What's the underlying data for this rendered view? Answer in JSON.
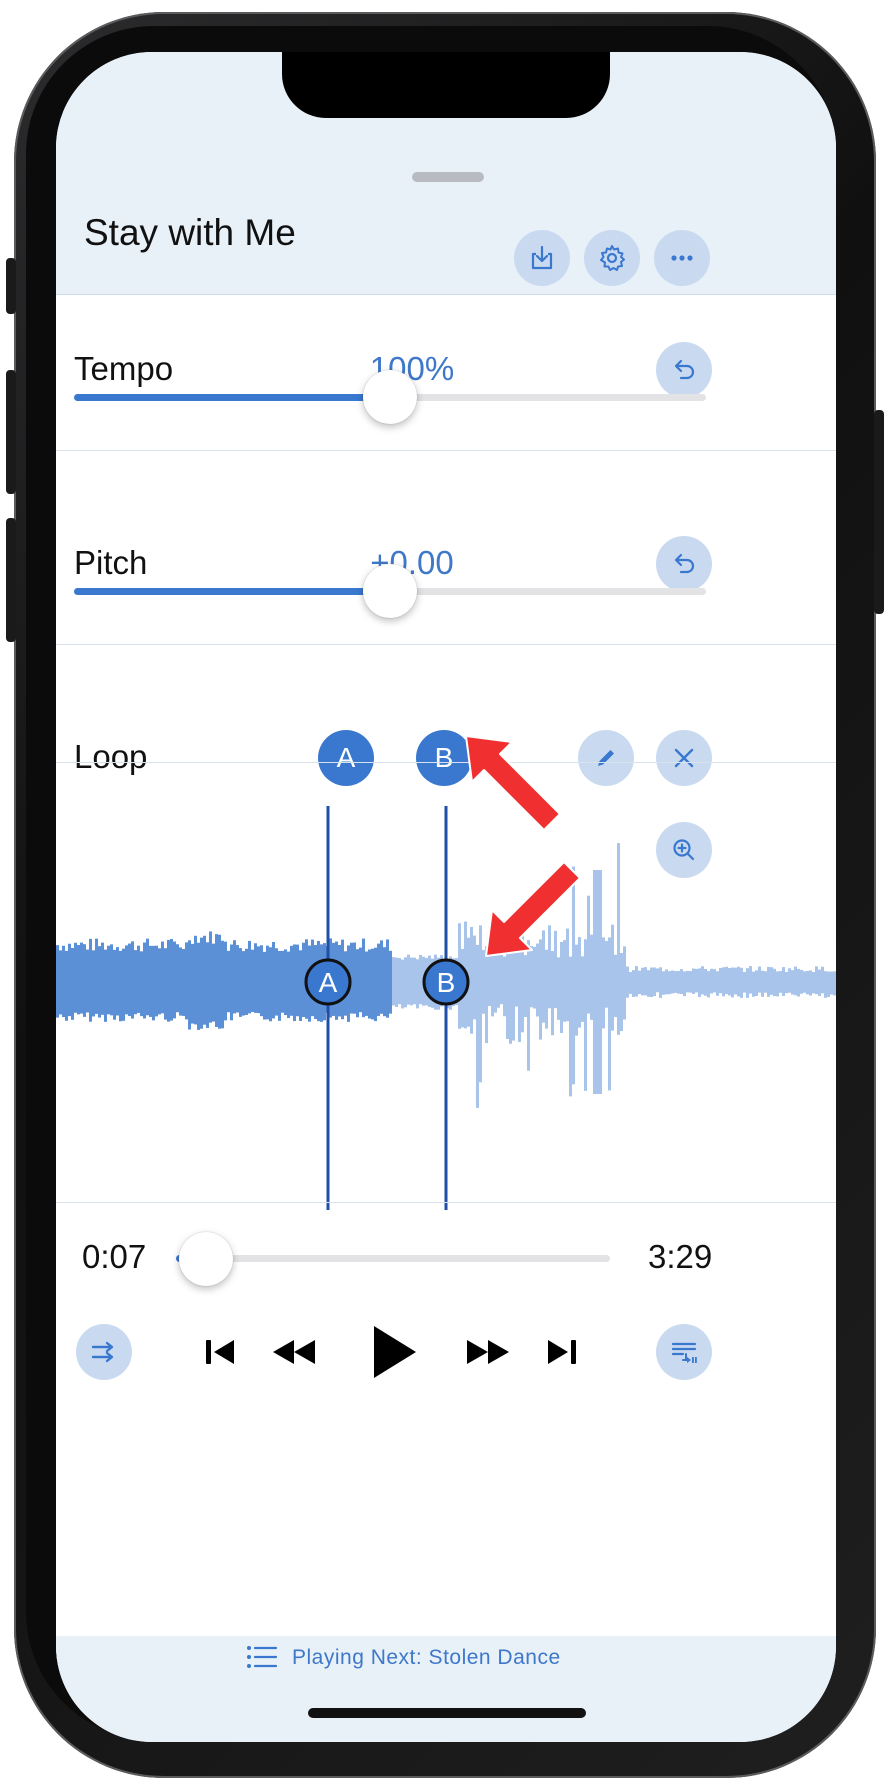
{
  "header": {
    "title": "Stay with Me"
  },
  "tempo": {
    "label": "Tempo",
    "value": "100%",
    "slider_fraction": 0.5
  },
  "pitch": {
    "label": "Pitch",
    "value": "+0.00",
    "slider_fraction": 0.5
  },
  "loop": {
    "label": "Loop",
    "a_label": "A",
    "b_label": "B"
  },
  "waveform": {
    "marker_a_label": "A",
    "marker_b_label": "B"
  },
  "playback": {
    "elapsed": "0:07",
    "total": "3:29",
    "progress_fraction": 0.07
  },
  "footer": {
    "playing_next": "Playing Next: Stolen Dance"
  },
  "colors": {
    "accent": "#3a78d0",
    "header_bg": "#e8f0f8",
    "button_bg": "#c9daf0",
    "annotation_arrow": "#f03030"
  },
  "icons": [
    "download-icon",
    "gear-icon",
    "more-icon",
    "undo-icon",
    "pencil-icon",
    "close-icon",
    "zoom-in-icon",
    "shuffle-icon",
    "skip-back-icon",
    "rewind-icon",
    "play-icon",
    "fast-forward-icon",
    "skip-forward-icon",
    "queue-icon",
    "list-icon"
  ]
}
